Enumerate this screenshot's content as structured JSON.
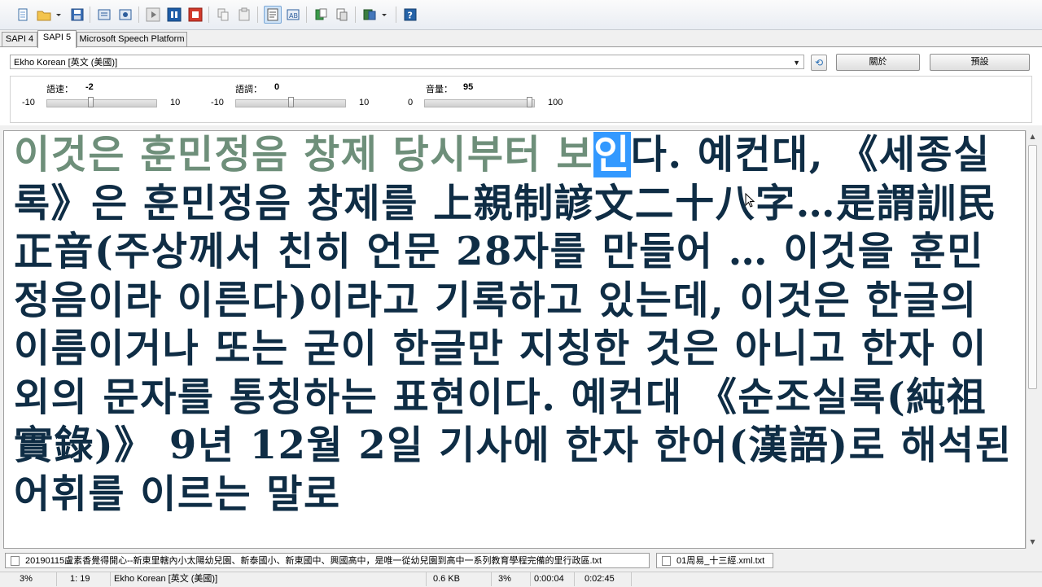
{
  "toolbar": {
    "icons": [
      "new-file",
      "open-folder",
      "open-dropdown",
      "save",
      "read-aloud",
      "read-aloud-alt",
      "play",
      "pause",
      "stop",
      "copy",
      "paste",
      "text-view",
      "text-format",
      "export",
      "import",
      "clipboard-monitor",
      "dropdown",
      "help"
    ]
  },
  "tabs": [
    {
      "label": "SAPI 4",
      "selected": false
    },
    {
      "label": "SAPI 5",
      "selected": true
    },
    {
      "label": "Microsoft Speech Platform",
      "selected": false
    }
  ],
  "voice": {
    "selected": "Ekho Korean [英文 (美國)]",
    "about_label": "關於",
    "default_label": "預設"
  },
  "sliders": {
    "speed": {
      "label": "語速：",
      "value": "-2",
      "min": "-10",
      "max": "10",
      "level": 0.4
    },
    "pitch": {
      "label": "語調：",
      "value": "0",
      "min": "-10",
      "max": "10",
      "level": 0.5
    },
    "volume": {
      "label": "音量：",
      "value": "95",
      "min": "0",
      "max": "100",
      "level": 0.95
    }
  },
  "editor": {
    "spoken": "이것은 훈민정음 창제 당시부터 보",
    "current": "인",
    "rest": "다. 예컨대, 《세종실록》은 훈민정음 창제를 上親制諺文二十八字…是謂訓民正音(주상께서 친히 언문 28자를 만들어 … 이것을 훈민정음이라 이른다)이라고 기록하고 있는데, 이것은 한글의 이름이거나 또는 굳이 한글만 지칭한 것은 아니고 한자 이외의 문자를 통칭하는 표현이다. 예컨대 《순조실록(純祖實錄)》 9년 12월 2일 기사에 한자 한어(漢語)로 해석된 어휘를 이르는 말로"
  },
  "doc_tabs": [
    "20190115盧素香覺得開心--新東里轄內小太陽幼兒園、新泰國小、新東國中、興國高中，是唯一從幼兒園到高中一系列教育學程完備的里行政區.txt",
    "01周易_十三經.xml.txt"
  ],
  "status": {
    "percent": "3%",
    "position": "1: 19",
    "voice": "Ekho Korean [英文 (美國)]",
    "size": "0.6 KB",
    "progress": "3%",
    "elapsed": "0:00:04",
    "total": "0:02:45"
  }
}
